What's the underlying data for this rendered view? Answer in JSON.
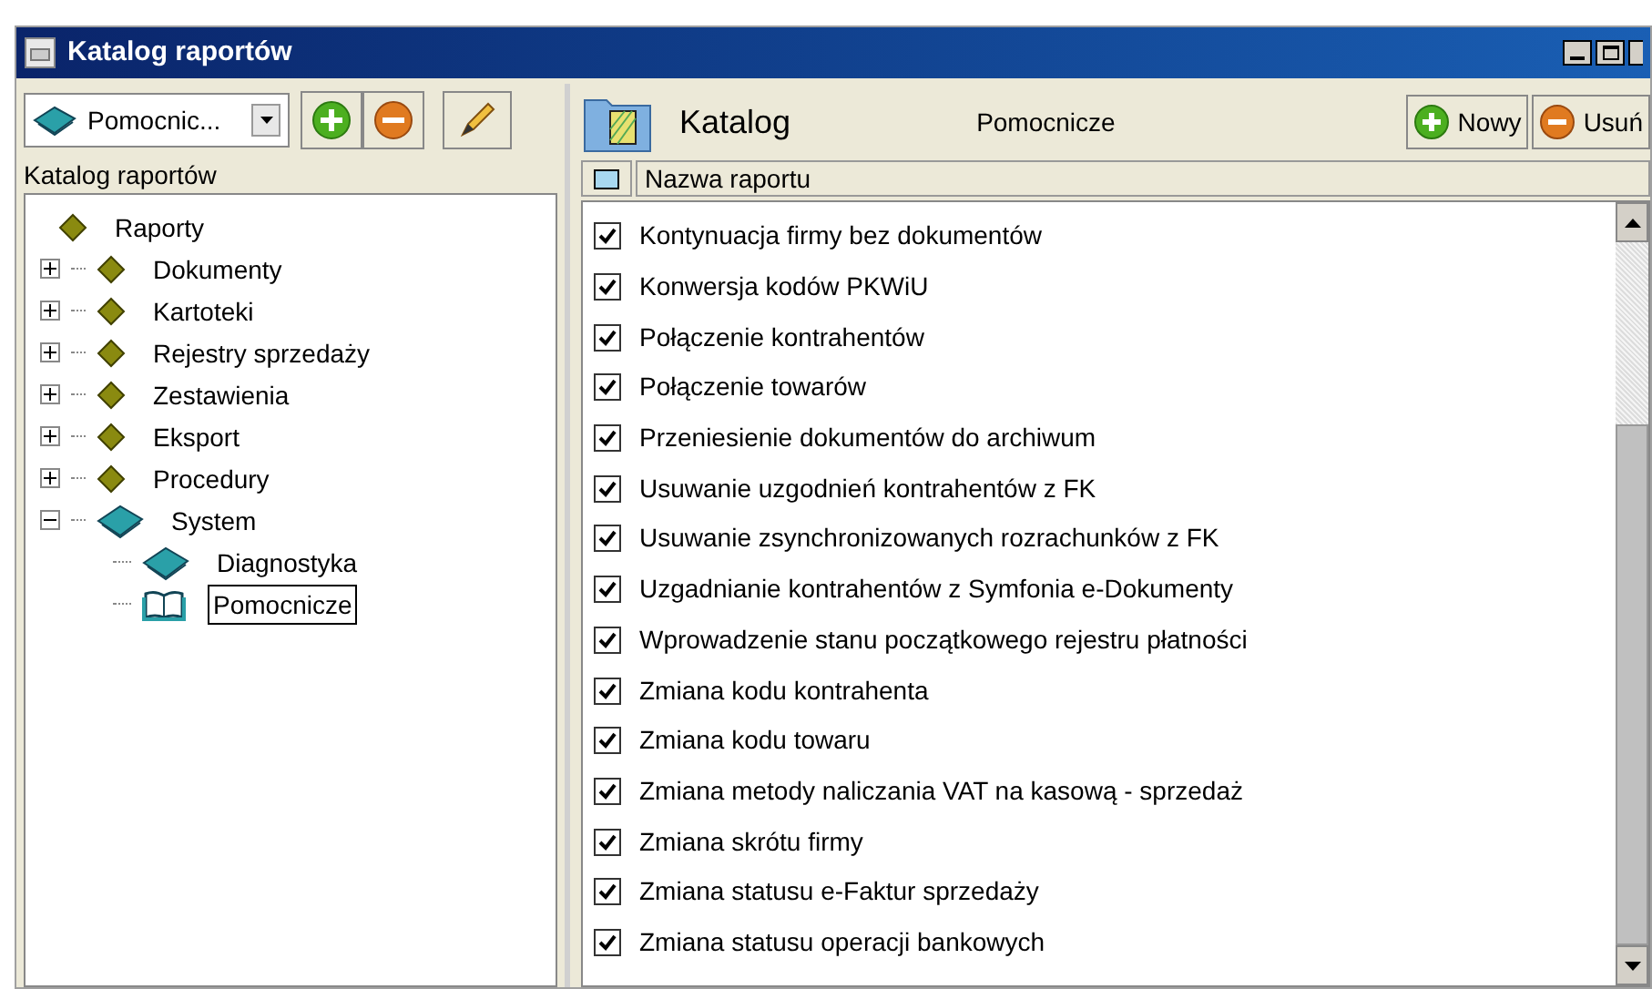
{
  "window": {
    "title": "Katalog raportów"
  },
  "left_toolbar": {
    "dropdown_value": "Pomocnic..."
  },
  "tree_header": "Katalog raportów",
  "tree": [
    {
      "label": "Raporty",
      "kind": "category",
      "children": [
        {
          "label": "Dokumenty",
          "kind": "category",
          "expanded": false,
          "selected": false
        },
        {
          "label": "Kartoteki",
          "kind": "category",
          "expanded": false,
          "selected": false
        },
        {
          "label": "Rejestry sprzedaży",
          "kind": "category",
          "expanded": false,
          "selected": false
        },
        {
          "label": "Zestawienia",
          "kind": "category",
          "expanded": false,
          "selected": false
        },
        {
          "label": "Eksport",
          "kind": "category",
          "expanded": false,
          "selected": false
        },
        {
          "label": "Procedury",
          "kind": "category",
          "expanded": false,
          "selected": false
        },
        {
          "label": "System",
          "kind": "book",
          "expanded": true,
          "selected": false,
          "children": [
            {
              "label": "Diagnostyka",
              "kind": "book",
              "selected": false
            },
            {
              "label": "Pomocnicze",
              "kind": "open-book",
              "selected": true
            }
          ]
        }
      ]
    }
  ],
  "right_header": {
    "title": "Katalog",
    "subtitle": "Pomocnicze",
    "buttons": [
      {
        "label": "Nowy",
        "kind": "add"
      },
      {
        "label": "Usuń",
        "kind": "remove"
      }
    ]
  },
  "list": {
    "column": "Nazwa raportu",
    "rows": [
      {
        "name": "Kontynuacja firmy bez dokumentów",
        "checked": true
      },
      {
        "name": "Konwersja kodów PKWiU",
        "checked": true
      },
      {
        "name": "Połączenie kontrahentów",
        "checked": true
      },
      {
        "name": "Połączenie towarów",
        "checked": true
      },
      {
        "name": "Przeniesienie dokumentów do archiwum",
        "checked": true
      },
      {
        "name": "Usuwanie uzgodnień kontrahentów z FK",
        "checked": true
      },
      {
        "name": "Usuwanie zsynchronizowanych rozrachunków z FK",
        "checked": true
      },
      {
        "name": "Uzgadnianie kontrahentów z Symfonia e-Dokumenty",
        "checked": true
      },
      {
        "name": "Wprowadzenie stanu początkowego rejestru płatności",
        "checked": true
      },
      {
        "name": "Zmiana kodu kontrahenta",
        "checked": true
      },
      {
        "name": "Zmiana kodu towaru",
        "checked": true
      },
      {
        "name": "Zmiana metody naliczania VAT na kasową - sprzedaż",
        "checked": true
      },
      {
        "name": "Zmiana skrótu firmy",
        "checked": true
      },
      {
        "name": "Zmiana statusu e-Faktur sprzedaży",
        "checked": true
      },
      {
        "name": "Zmiana statusu operacji bankowych",
        "checked": true
      }
    ]
  }
}
